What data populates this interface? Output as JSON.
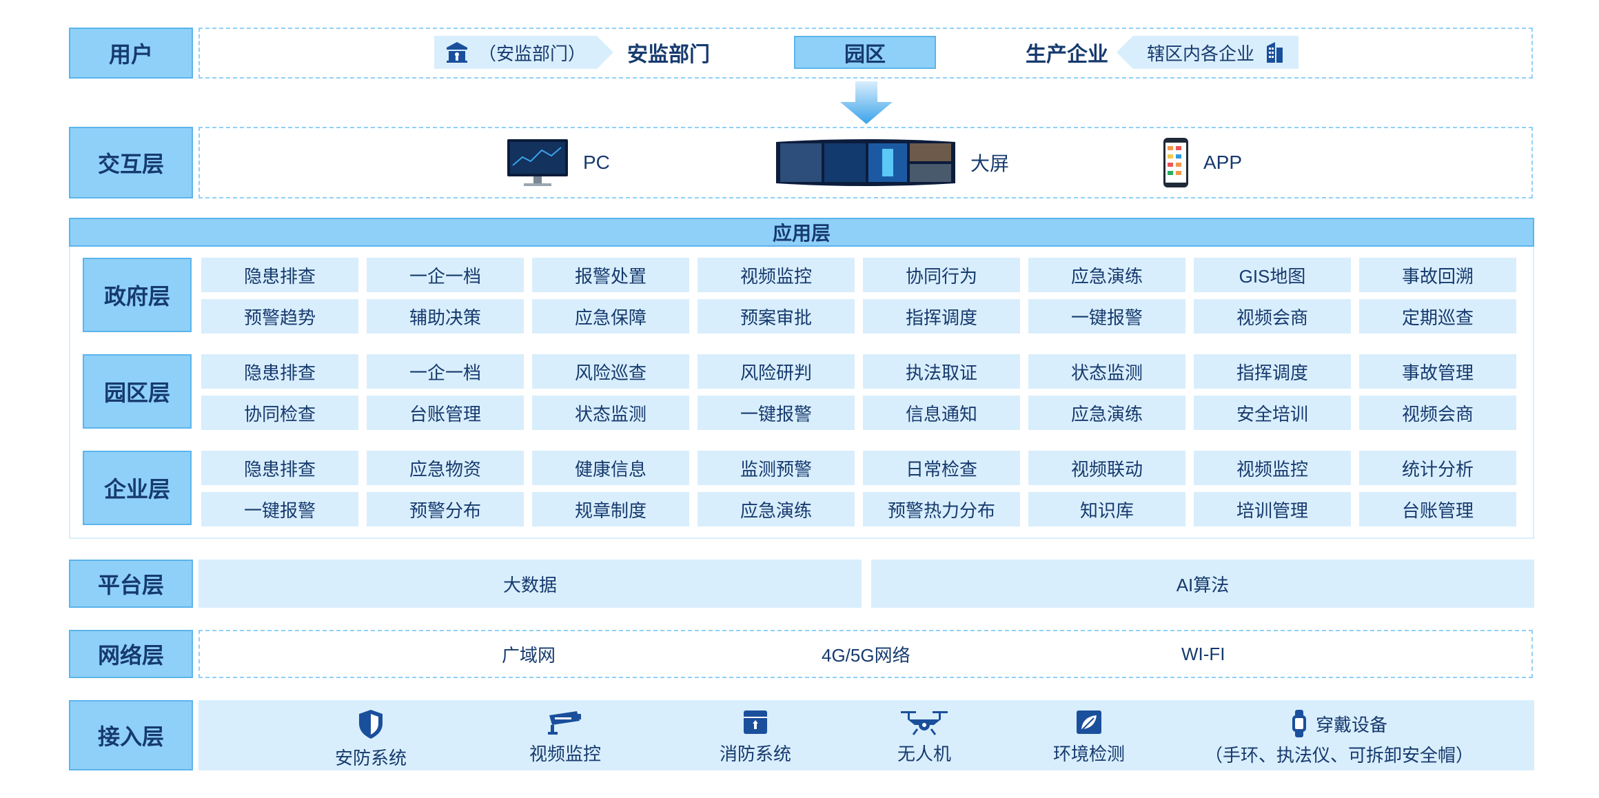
{
  "layers": {
    "user": "用户",
    "interaction": "交互层",
    "platform": "平台层",
    "network": "网络层",
    "access": "接入层"
  },
  "user_row": {
    "left_pill": "（安监部门）",
    "left_text": "安监部门",
    "center": "园区",
    "right_text": "生产企业",
    "right_pill": "辖区内各企业"
  },
  "interaction": [
    {
      "label": "PC",
      "icon": "monitor-icon"
    },
    {
      "label": "大屏",
      "icon": "big-screen-icon"
    },
    {
      "label": "APP",
      "icon": "phone-icon"
    }
  ],
  "application": {
    "title": "应用层",
    "groups": [
      {
        "label": "政府层",
        "rows": [
          [
            "隐患排查",
            "一企一档",
            "报警处置",
            "视频监控",
            "协同行为",
            "应急演练",
            "GIS地图",
            "事故回溯"
          ],
          [
            "预警趋势",
            "辅助决策",
            "应急保障",
            "预案审批",
            "指挥调度",
            "一键报警",
            "视频会商",
            "定期巡查"
          ]
        ]
      },
      {
        "label": "园区层",
        "rows": [
          [
            "隐患排查",
            "一企一档",
            "风险巡查",
            "风险研判",
            "执法取证",
            "状态监测",
            "指挥调度",
            "事故管理"
          ],
          [
            "协同检查",
            "台账管理",
            "状态监测",
            "一键报警",
            "信息通知",
            "应急演练",
            "安全培训",
            "视频会商"
          ]
        ]
      },
      {
        "label": "企业层",
        "rows": [
          [
            "隐患排查",
            "应急物资",
            "健康信息",
            "监测预警",
            "日常检查",
            "视频联动",
            "视频监控",
            "统计分析"
          ],
          [
            "一键报警",
            "预警分布",
            "规章制度",
            "应急演练",
            "预警热力分布",
            "知识库",
            "培训管理",
            "台账管理"
          ]
        ]
      }
    ]
  },
  "platform": [
    "大数据",
    "AI算法"
  ],
  "network": [
    "广域网",
    "4G/5G网络",
    "WI-FI"
  ],
  "access": [
    {
      "label": "安防系统",
      "icon": "shield-icon"
    },
    {
      "label": "视频监控",
      "icon": "camera-icon"
    },
    {
      "label": "消防系统",
      "icon": "fire-box-icon"
    },
    {
      "label": "无人机",
      "icon": "drone-icon"
    },
    {
      "label": "环境检测",
      "icon": "leaf-icon"
    },
    {
      "label": "穿戴设备",
      "sub": "（手环、执法仪、可拆卸安全帽）",
      "icon": "watch-icon"
    }
  ],
  "colors": {
    "accent": "#8fd0f8",
    "light": "#d9eefc",
    "icon": "#1a4f9c",
    "text": "#163a6e"
  }
}
